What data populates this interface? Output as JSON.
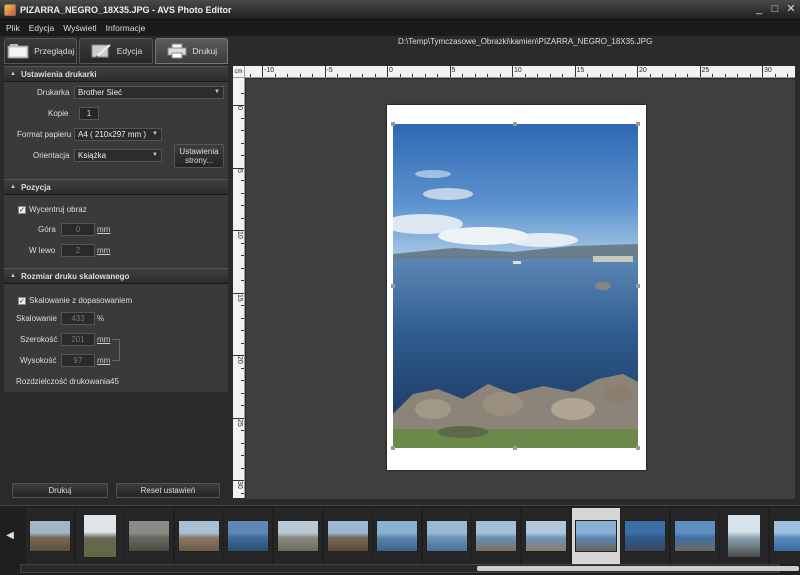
{
  "window": {
    "title": "PIZARRA_NEGRO_18X35.JPG  -  AVS Photo Editor",
    "controls": [
      "_",
      "□",
      "✕"
    ]
  },
  "menu": [
    "Plik",
    "Edycja",
    "Wyświetl",
    "Informacje"
  ],
  "tabs": [
    {
      "label": "Przeglądaj",
      "icon": "browse-icon"
    },
    {
      "label": "Edycja",
      "icon": "edit-icon"
    },
    {
      "label": "Drukuj",
      "icon": "printer-icon",
      "active": true
    }
  ],
  "printer_settings": {
    "header": "Ustawienia drukarki",
    "printer_label": "Drukarka",
    "printer_value": "Brother Sieć",
    "copies_label": "Kopie",
    "copies_value": "1",
    "paper_label": "Format papieru",
    "paper_value": "A4 ( 210x297 mm )",
    "orientation_label": "Orientacja",
    "orientation_value": "Książka",
    "page_settings_button": "Ustawienia strony..."
  },
  "position": {
    "header": "Pozycja",
    "center_label": "Wycentruj obraz",
    "center_checked": true,
    "top_label": "Góra",
    "top_value": "0",
    "top_unit": "mm",
    "left_label": "W lewo",
    "left_value": "2",
    "left_unit": "mm"
  },
  "scaling": {
    "header": "Rozmiar druku skalowanego",
    "fit_label": "Skalowanie z dopasowaniem",
    "fit_checked": true,
    "scale_label": "Skalowanie",
    "scale_value": "433",
    "scale_unit": "%",
    "width_label": "Szerokość",
    "width_value": "201",
    "width_unit": "mm",
    "height_label": "Wysokość",
    "height_value": "97",
    "height_unit": "mm",
    "resolution_label": "Rozdzielczość drukowania",
    "resolution_value": "45"
  },
  "actions": {
    "print_button": "Drukuj",
    "reset_button": "Reset ustawień"
  },
  "file_path": "D:\\Temp\\Tymczasowe_Obrazki\\kamien\\PIZARRA_NEGRO_18X35.JPG",
  "ruler": {
    "unit": "cm",
    "h_labels": [
      "-10",
      "-5",
      "0",
      "5",
      "10",
      "15",
      "20",
      "25",
      "30"
    ],
    "v_labels": [
      "0",
      "5",
      "10",
      "15",
      "20",
      "25",
      "30"
    ]
  },
  "filmstrip": {
    "thumbnails": [
      {
        "name": "thumb-ruins",
        "colors": [
          "#9fb8c8",
          "#7a6a55",
          "#5a4e3e"
        ]
      },
      {
        "name": "thumb-tree",
        "colors": [
          "#dfe6ea",
          "#6e6555",
          "#5a6a3e"
        ],
        "portrait": true
      },
      {
        "name": "thumb-stones",
        "colors": [
          "#8a8a86",
          "#6a6660",
          "#4e4a44"
        ]
      },
      {
        "name": "thumb-town",
        "colors": [
          "#a8c0d4",
          "#8a7a64",
          "#6a5a48"
        ]
      },
      {
        "name": "thumb-harbor",
        "colors": [
          "#5e88b8",
          "#3e6a9a",
          "#2e4e72"
        ]
      },
      {
        "name": "thumb-street",
        "colors": [
          "#b8c8d4",
          "#8a8a80",
          "#6a6a60"
        ]
      },
      {
        "name": "thumb-village",
        "colors": [
          "#9ab8d4",
          "#7a6a5a",
          "#5a4a3a"
        ]
      },
      {
        "name": "thumb-sea1",
        "colors": [
          "#8ab0d0",
          "#5a88b0",
          "#3e6088"
        ]
      },
      {
        "name": "thumb-sea2",
        "colors": [
          "#9ab8d4",
          "#6a94b8",
          "#4a7098"
        ]
      },
      {
        "name": "thumb-coast1",
        "colors": [
          "#a4c0d8",
          "#6a90b4",
          "#7a7060"
        ]
      },
      {
        "name": "thumb-coast2",
        "colors": [
          "#b0c8dc",
          "#6e96ba",
          "#8a7e6a"
        ]
      },
      {
        "name": "thumb-selected",
        "colors": [
          "#8ab0d4",
          "#5a86b4",
          "#6a665c"
        ],
        "selected": true
      },
      {
        "name": "thumb-sea3",
        "colors": [
          "#3e6ea8",
          "#2e5a90",
          "#3a4a5a"
        ]
      },
      {
        "name": "thumb-sea4",
        "colors": [
          "#5e8ec0",
          "#3e70a4",
          "#6a6a62"
        ]
      },
      {
        "name": "thumb-pier",
        "colors": [
          "#d8e2ea",
          "#8aa0b0",
          "#4a4a48"
        ],
        "portrait": true
      },
      {
        "name": "thumb-sea5",
        "colors": [
          "#9ec0e0",
          "#5a8cc0",
          "#3a6a9c"
        ]
      }
    ]
  }
}
